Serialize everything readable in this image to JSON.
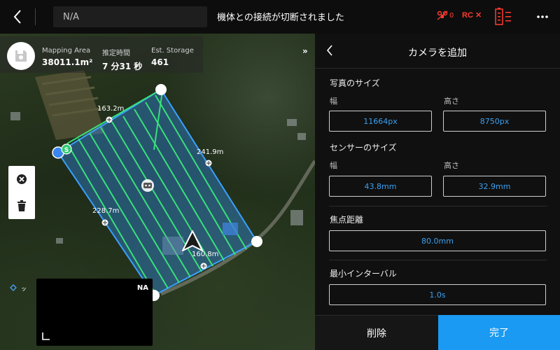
{
  "topbar": {
    "field_value": "N/A",
    "connection_message": "機体との接続が切断されました",
    "drone_status_count": "0",
    "rc_label": "RC",
    "rc_mark": "✕"
  },
  "map": {
    "stats": [
      {
        "label": "Mapping Area",
        "value": "38011.1m²"
      },
      {
        "label": "推定時間",
        "value": "7 分31 秒"
      },
      {
        "label": "Est. Storage",
        "value": "461"
      }
    ],
    "collapse_glyph": "»",
    "edge_labels": {
      "top": "163.2m",
      "right": "241.9m",
      "left": "228.7m",
      "bottom": "160.8m"
    },
    "start_marker": "S",
    "mini_panel_label": "NA"
  },
  "panel": {
    "title": "カメラを追加",
    "photo_size": {
      "title": "写真のサイズ",
      "width_label": "幅",
      "width_value": "11664px",
      "height_label": "高さ",
      "height_value": "8750px"
    },
    "sensor_size": {
      "title": "センサーのサイズ",
      "width_label": "幅",
      "width_value": "43.8mm",
      "height_label": "高さ",
      "height_value": "32.9mm"
    },
    "focal_length": {
      "title": "焦点距離",
      "value": "80.0mm"
    },
    "min_interval": {
      "title": "最小インターバル",
      "value": "1.0s"
    },
    "delete_label": "削除",
    "done_label": "完了"
  },
  "colors": {
    "accent": "#1a9af2",
    "value_text": "#3ba1f2",
    "warning": "#ff3b30",
    "flight_line": "#39e07a",
    "area_fill": "#2f86d8"
  }
}
